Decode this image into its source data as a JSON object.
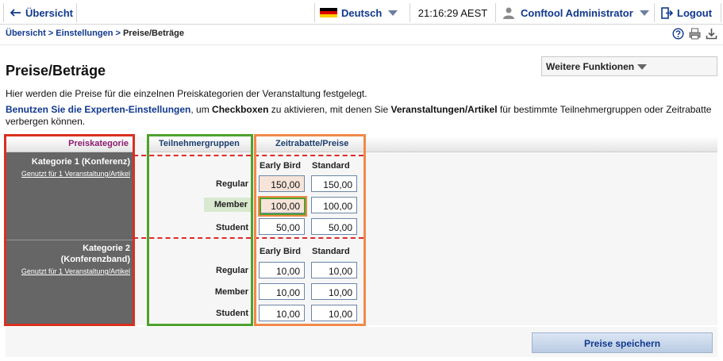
{
  "topbar": {
    "home_label": "Übersicht",
    "language": "Deutsch",
    "time": "21:16:29 AEST",
    "user": "Conftool Administrator",
    "logout_label": "Logout"
  },
  "breadcrumb": {
    "items": [
      "Übersicht",
      "Einstellungen"
    ],
    "separator": " > ",
    "current": "Preise/Beträge"
  },
  "page": {
    "title": "Preise/Beträge",
    "more_functions": "Weitere Funktionen",
    "intro": "Hier werden die Preise für die einzelnen Preiskategorien der Veranstaltung festgelegt.",
    "expert_link": "Benutzen Sie die Experten-Einstellungen",
    "expert_t1": ", um ",
    "expert_b1": "Checkboxen",
    "expert_t2": " zu aktivieren, mit denen Sie ",
    "expert_b2": "Veranstaltungen/Artikel",
    "expert_t3": " für bestimmte Teilnehmergruppen oder Zeitrabatte verbergen können."
  },
  "table": {
    "headers": {
      "category": "Preiskategorie",
      "groups": "Teilnehmergruppen",
      "discounts": "Zeitrabatte/Preise"
    },
    "categories": [
      {
        "title": "Kategorie 1 (Konferenz)",
        "usage": "Genutzt für 1 Veranstaltung/Artikel",
        "columns": [
          "Early Bird",
          "Standard"
        ],
        "rows": [
          {
            "group": "Regular",
            "prices": [
              "150,00",
              "150,00"
            ]
          },
          {
            "group": "Member",
            "prices": [
              "100,00",
              "100,00"
            ]
          },
          {
            "group": "Student",
            "prices": [
              "50,00",
              "50,00"
            ]
          }
        ]
      },
      {
        "title_line1": "Kategorie 2",
        "title_line2": "(Konferenzband)",
        "usage": "Genutzt für 1 Veranstaltung/Artikel",
        "columns": [
          "Early Bird",
          "Standard"
        ],
        "rows": [
          {
            "group": "Regular",
            "prices": [
              "10,00",
              "10,00"
            ]
          },
          {
            "group": "Member",
            "prices": [
              "10,00",
              "10,00"
            ]
          },
          {
            "group": "Student",
            "prices": [
              "10,00",
              "10,00"
            ]
          }
        ]
      }
    ]
  },
  "save_label": "Preise speichern",
  "colors": {
    "link": "#10388f",
    "category_col": "#666666",
    "highlight_red": "#e02828",
    "highlight_green": "#4ea12e",
    "highlight_orange": "#f0894a",
    "member_bg": "#d9e9cf",
    "early_bird_bg": "#f6e4d9"
  },
  "icons": [
    "arrow-left-icon",
    "german-flag-icon",
    "chevron-down-icon",
    "user-icon",
    "logout-icon",
    "help-icon",
    "print-icon",
    "download-icon"
  ]
}
